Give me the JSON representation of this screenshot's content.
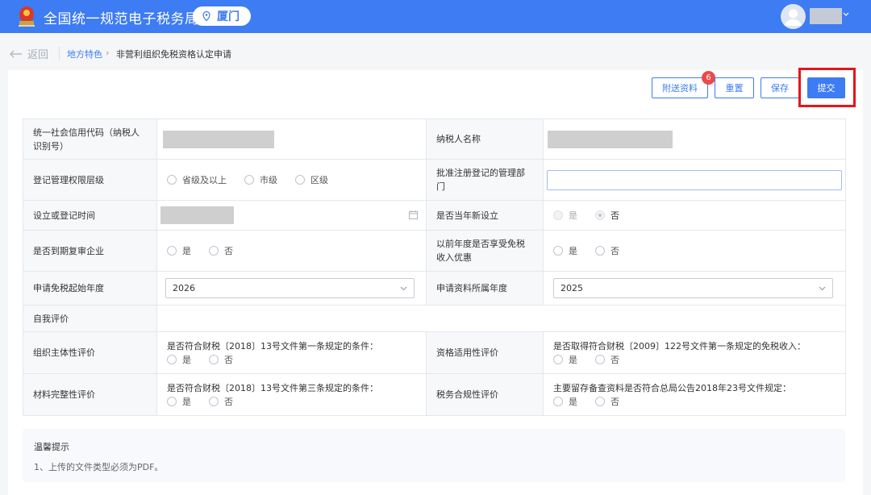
{
  "header": {
    "site_title": "全国统一规范电子税务局",
    "city": "厦门",
    "accent": "#3d7cf2"
  },
  "breadcrumb": {
    "back_label": "返回",
    "items": [
      "地方特色",
      "非营利组织免税资格认定申请"
    ],
    "separator": "›"
  },
  "toolbar": {
    "attach_label": "附送资料",
    "attach_badge": "6",
    "reset_label": "重置",
    "save_label": "保存",
    "submit_label": "提交"
  },
  "form": {
    "credit_code_label": "统一社会信用代码（纳税人识别号）",
    "taxpayer_name_label": "纳税人名称",
    "reg_level_label": "登记管理权限层级",
    "reg_level_options": [
      "省级及以上",
      "市级",
      "区级"
    ],
    "approval_dept_label": "批准注册登记的管理部门",
    "reg_time_label": "设立或登记时间",
    "new_this_year_label": "是否当年新设立",
    "new_this_year_options": [
      "是",
      "否"
    ],
    "review_due_label": "是否到期复审企业",
    "review_due_options": [
      "是",
      "否"
    ],
    "prior_exempt_label": "以前年度是否享受免税收入优惠",
    "prior_exempt_options": [
      "是",
      "否"
    ],
    "start_year_label": "申请免税起始年度",
    "start_year_value": "2026",
    "material_year_label": "申请资料所属年度",
    "material_year_value": "2025",
    "self_eval_label": "自我评价",
    "entity_eval_label": "组织主体性评价",
    "entity_eval_question": "是否符合财税〔2018〕13号文件第一条规定的条件：",
    "qualify_eval_label": "资格适用性评价",
    "qualify_eval_question": "是否取得符合财税〔2009〕122号文件第一条规定的免税收入：",
    "material_eval_label": "材料完整性评价",
    "material_eval_question": "是否符合财税〔2018〕13号文件第三条规定的条件：",
    "tax_eval_label": "税务合规性评价",
    "tax_eval_question": "主要留存备查资料是否符合总局公告2018年23号文件规定：",
    "yes": "是",
    "no": "否"
  },
  "tips": {
    "title": "温馨提示",
    "line1": "1、上传的文件类型必须为PDF。"
  }
}
